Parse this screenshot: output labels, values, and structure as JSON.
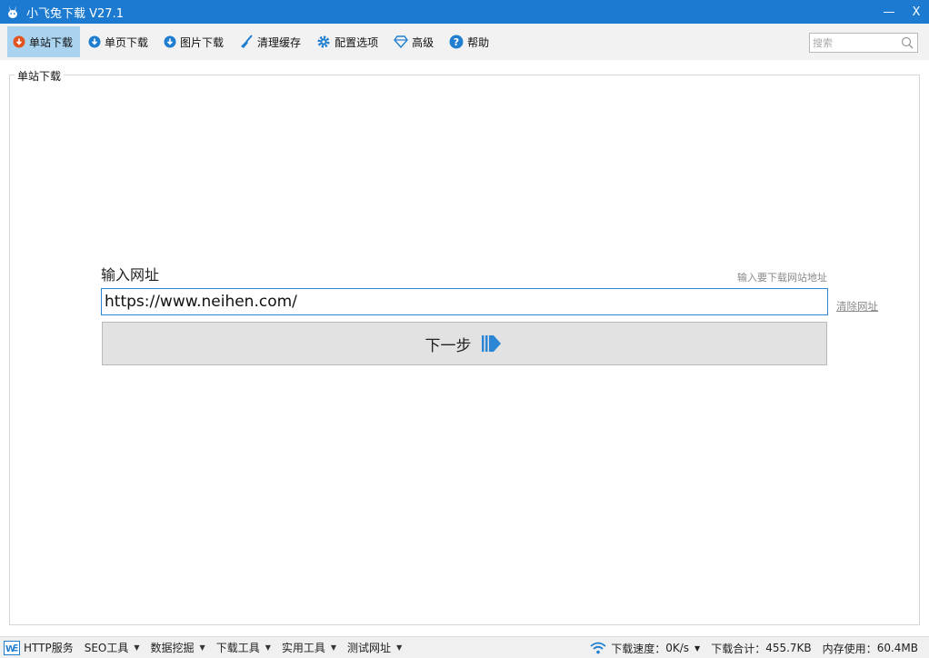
{
  "window": {
    "title": "小飞兔下载 V27.1",
    "minimize_label": "—",
    "close_label": "X"
  },
  "toolbar": {
    "items": [
      {
        "label": "单站下载",
        "icon": "download-icon-red",
        "active": true
      },
      {
        "label": "单页下载",
        "icon": "download-icon-blue"
      },
      {
        "label": "图片下载",
        "icon": "download-icon-blue"
      },
      {
        "label": "清理缓存",
        "icon": "broom-icon"
      },
      {
        "label": "配置选项",
        "icon": "gear-icon"
      },
      {
        "label": "高级",
        "icon": "diamond-icon"
      },
      {
        "label": "帮助",
        "icon": "help-icon"
      }
    ],
    "search_placeholder": "搜索"
  },
  "main": {
    "group_title": "单站下载",
    "url_label": "输入网址",
    "url_hint": "输入要下载网站地址",
    "url_value": "https://www.neihen.com/",
    "clear_label": "清除网址",
    "next_label": "下一步"
  },
  "statusbar": {
    "menus": [
      {
        "label": "HTTP服务",
        "dropdown": false
      },
      {
        "label": "SEO工具",
        "dropdown": true
      },
      {
        "label": "数据挖掘",
        "dropdown": true
      },
      {
        "label": "下载工具",
        "dropdown": true
      },
      {
        "label": "实用工具",
        "dropdown": true
      },
      {
        "label": "测试网址",
        "dropdown": true
      }
    ],
    "speed_label": "下载速度：",
    "speed_value": "0K/s",
    "total_label": "下载合计：",
    "total_value": "455.7KB",
    "memory_label": "内存使用：",
    "memory_value": "60.4MB"
  },
  "colors": {
    "titlebar": "#1c7ad0",
    "accent": "#2b86d6",
    "active_tab": "#a9d3ef"
  }
}
